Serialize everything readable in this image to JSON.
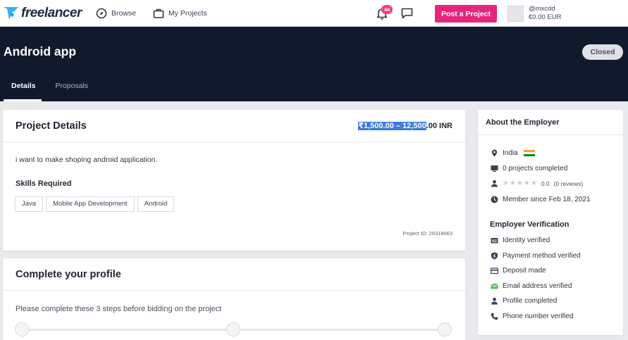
{
  "nav": {
    "brand": "freelancer",
    "browse_label": "Browse",
    "my_projects_label": "My Projects",
    "notification_count": "44",
    "post_project_label": "Post a Project",
    "username": "@mxcdd",
    "balance": "€0.00 EUR"
  },
  "project": {
    "title": "Android app",
    "status": "Closed",
    "tabs": [
      {
        "label": "Details",
        "active": true
      },
      {
        "label": "Proposals",
        "active": false
      }
    ]
  },
  "details": {
    "heading": "Project Details",
    "budget_selected": "₹1,500.00 – 12,500",
    "budget_rest": ".00 INR",
    "description": "i want to make shoping android application.",
    "skills_label": "Skills Required",
    "skills": [
      "Java",
      "Mobile App Development",
      "Android"
    ],
    "project_id": "Project ID: 29318663"
  },
  "complete_profile": {
    "heading": "Complete your profile",
    "text": "Please complete these 3 steps before bidding on the project",
    "steps": 3
  },
  "employer": {
    "heading": "About the Employer",
    "country": "India",
    "projects_completed": "0 projects completed",
    "rating": "0.0",
    "reviews": "(0 reviews)",
    "stars_filled": 0,
    "member_since": "Member since Feb 18, 2021",
    "verification_heading": "Employer Verification",
    "verifications": [
      "Identity verified",
      "Payment method verified",
      "Deposit made",
      "Email address verified",
      "Profile completed",
      "Phone number verified"
    ]
  },
  "colors": {
    "accent_pink": "#e6267d",
    "header_dark": "#111a2c",
    "selection_blue": "#3b7ae0",
    "email_icon_green": "#5cb85c"
  }
}
